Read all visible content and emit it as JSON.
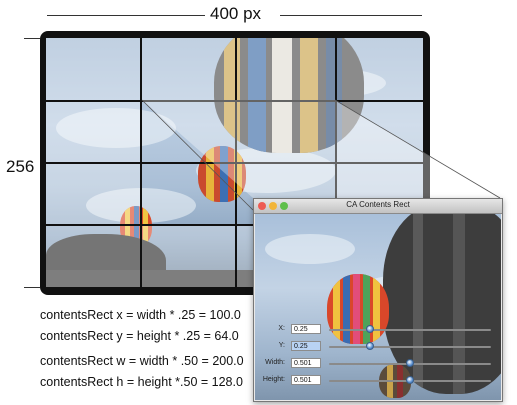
{
  "dimensions": {
    "width_label": "400 px",
    "height_label": "256"
  },
  "window": {
    "title": "CA Contents Rect",
    "controls": [
      {
        "label": "X:",
        "value": "0.25",
        "level": 0.25
      },
      {
        "label": "Y:",
        "value": "0.25",
        "level": 0.25
      },
      {
        "label": "Width:",
        "value": "0.501",
        "level": 0.501
      },
      {
        "label": "Height:",
        "value": "0.501",
        "level": 0.501
      }
    ],
    "traffic_colors": [
      "#ee5b52",
      "#f2b53a",
      "#5fbf4a"
    ]
  },
  "equations": [
    "contentsRect x = width * .25 = 100.0",
    "contentsRect y = height * .25 = 64.0",
    "contentsRect w = width * .50 = 200.0",
    "contentsRect h = height *.50 = 128.0"
  ]
}
